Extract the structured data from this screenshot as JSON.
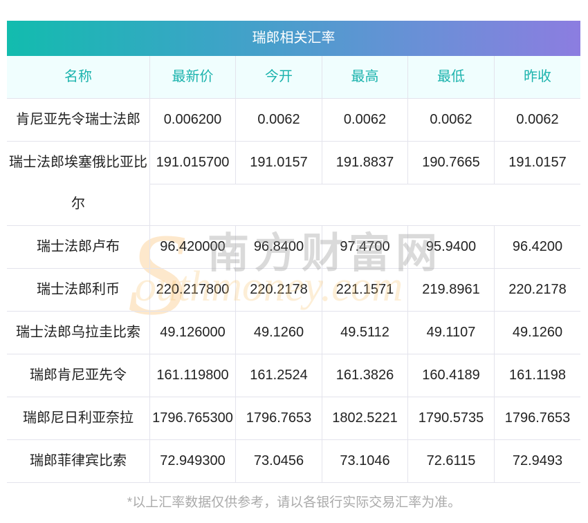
{
  "title": "瑞郎相关汇率",
  "headers": [
    "名称",
    "最新价",
    "今开",
    "最高",
    "最低",
    "昨收"
  ],
  "rows": [
    [
      "肯尼亚先令瑞士法郎",
      "0.006200",
      "0.0062",
      "0.0062",
      "0.0062",
      "0.0062"
    ],
    [
      "瑞士法郎埃塞俄比亚比尔",
      "191.015700",
      "191.0157",
      "191.8837",
      "190.7665",
      "191.0157"
    ],
    [
      "瑞士法郎卢布",
      "96.420000",
      "96.8400",
      "97.4700",
      "95.9400",
      "96.4200"
    ],
    [
      "瑞士法郎利币",
      "220.217800",
      "220.2178",
      "221.1571",
      "219.8961",
      "220.2178"
    ],
    [
      "瑞士法郎乌拉圭比索",
      "49.126000",
      "49.1260",
      "49.5112",
      "49.1107",
      "49.1260"
    ],
    [
      "瑞郎肯尼亚先令",
      "161.119800",
      "161.2524",
      "161.3826",
      "160.4189",
      "161.1198"
    ],
    [
      "瑞郎尼日利亚奈拉",
      "1796.765300",
      "1796.7653",
      "1802.5221",
      "1790.5735",
      "1796.7653"
    ],
    [
      "瑞郎菲律宾比索",
      "72.949300",
      "73.0456",
      "73.1046",
      "72.6115",
      "72.9493"
    ]
  ],
  "watermark": {
    "cn": "南方财富网",
    "en": "southmoney.com"
  },
  "footer": "*以上汇率数据仅供参考，请以各银行实际交易汇率为准。"
}
